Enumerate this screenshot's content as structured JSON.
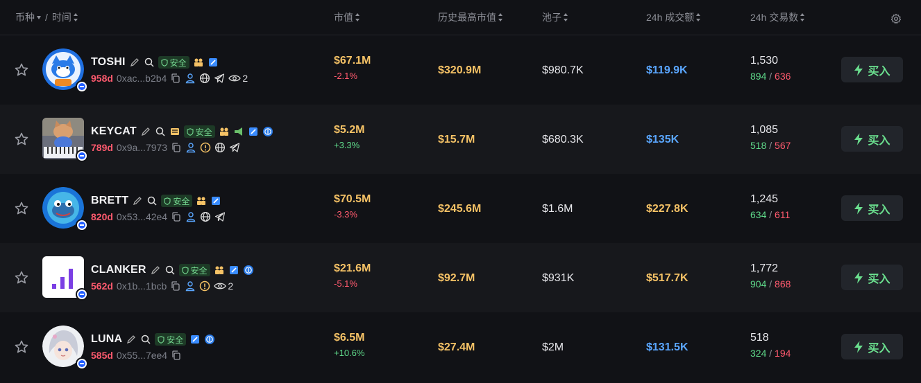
{
  "header": {
    "coin_time": "币种",
    "sep": "/",
    "time": "时间",
    "mcap": "市值",
    "ath": "历史最高市值",
    "pool": "池子",
    "vol": "24h 成交额",
    "txns": "24h 交易数"
  },
  "safe_label": "安全",
  "buy_label": "买入",
  "rows": [
    {
      "name": "TOSHI",
      "age": "958d",
      "addr": "0xac...b2b4",
      "watchers": "2",
      "mcap": "$67.1M",
      "change": "-2.1%",
      "ath": "$320.9M",
      "pool": "$980.7K",
      "vol": "$119.9K",
      "txns": "1,530",
      "buys": "894",
      "sells": "636"
    },
    {
      "name": "KEYCAT",
      "age": "789d",
      "addr": "0x9a...7973",
      "watchers": "",
      "mcap": "$5.2M",
      "change": "+3.3%",
      "ath": "$15.7M",
      "pool": "$680.3K",
      "vol": "$135K",
      "txns": "1,085",
      "buys": "518",
      "sells": "567"
    },
    {
      "name": "BRETT",
      "age": "820d",
      "addr": "0x53...42e4",
      "watchers": "",
      "mcap": "$70.5M",
      "change": "-3.3%",
      "ath": "$245.6M",
      "pool": "$1.6M",
      "vol": "$227.8K",
      "txns": "1,245",
      "buys": "634",
      "sells": "611"
    },
    {
      "name": "CLANKER",
      "age": "562d",
      "addr": "0x1b...1bcb",
      "watchers": "2",
      "mcap": "$21.6M",
      "change": "-5.1%",
      "ath": "$92.7M",
      "pool": "$931K",
      "vol": "$517.7K",
      "txns": "1,772",
      "buys": "904",
      "sells": "868"
    },
    {
      "name": "LUNA",
      "age": "585d",
      "addr": "0x55...7ee4",
      "watchers": "",
      "mcap": "$6.5M",
      "change": "+10.6%",
      "ath": "$27.4M",
      "pool": "$2M",
      "vol": "$131.5K",
      "txns": "518",
      "buys": "324",
      "sells": "194"
    }
  ]
}
